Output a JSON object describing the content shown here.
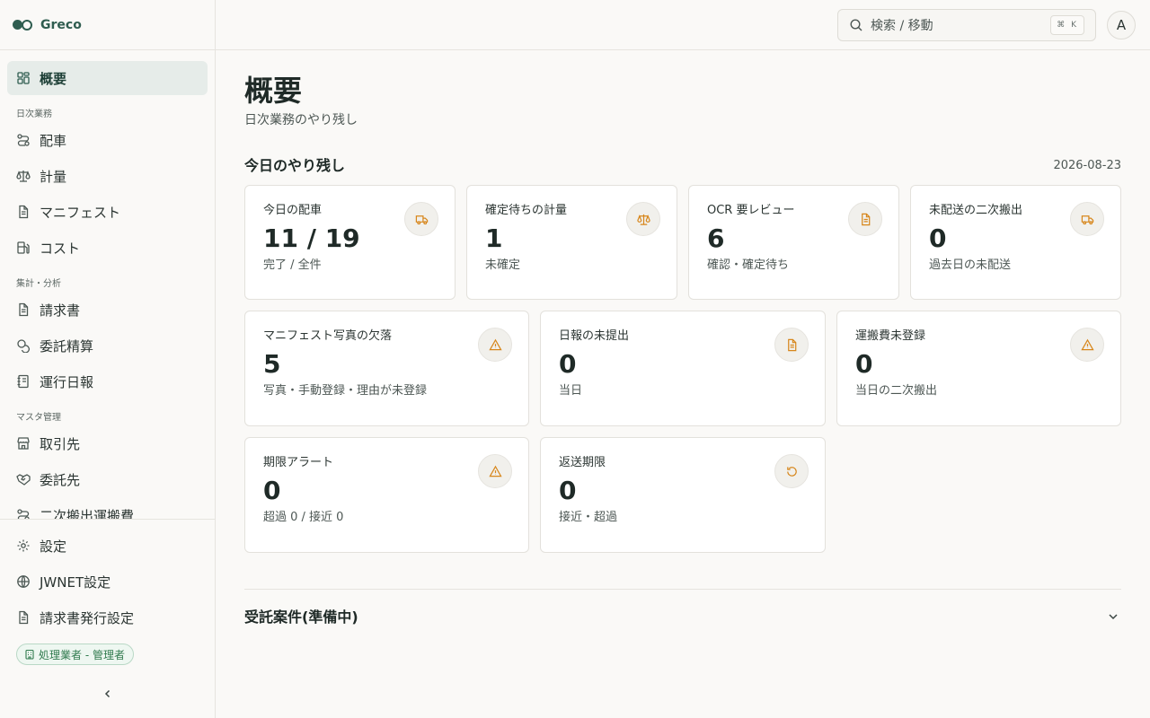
{
  "app": {
    "name": "Greco"
  },
  "sidebar": {
    "items": [
      {
        "label": "概要",
        "icon": "dashboard-icon",
        "active": true
      },
      {
        "section": "日次業務"
      },
      {
        "label": "配車",
        "icon": "route-icon"
      },
      {
        "label": "計量",
        "icon": "scale-icon"
      },
      {
        "label": "マニフェスト",
        "icon": "document-icon"
      },
      {
        "label": "コスト",
        "icon": "fuel-icon"
      },
      {
        "section": "集計・分析"
      },
      {
        "label": "請求書",
        "icon": "document-icon"
      },
      {
        "label": "委託精算",
        "icon": "coins-icon"
      },
      {
        "label": "運行日報",
        "icon": "notebook-icon"
      },
      {
        "section": "マスタ管理"
      },
      {
        "label": "取引先",
        "icon": "store-icon"
      },
      {
        "label": "委託先",
        "icon": "handshake-icon"
      },
      {
        "label": "二次搬出運搬費",
        "icon": "route-icon"
      }
    ],
    "bottom": [
      {
        "label": "設定",
        "icon": "gear-icon"
      },
      {
        "label": "JWNET設定",
        "icon": "globe-icon"
      },
      {
        "label": "請求書発行設定",
        "icon": "document-icon"
      }
    ],
    "role_badge": "処理業者 - 管理者"
  },
  "topbar": {
    "search_placeholder": "検索 / 移動",
    "shortcut": "⌘ K",
    "avatar_initial": "A"
  },
  "page": {
    "title": "概要",
    "subtitle": "日次業務のやり残し",
    "section_title": "今日のやり残し",
    "date": "2026-08-23"
  },
  "cards": [
    {
      "label": "今日の配車",
      "value": "11 / 19",
      "note": "完了 / 全件",
      "icon": "truck-icon"
    },
    {
      "label": "確定待ちの計量",
      "value": "1",
      "note": "未確定",
      "icon": "scale-icon"
    },
    {
      "label": "OCR 要レビュー",
      "value": "6",
      "note": "確認・確定待ち",
      "icon": "document-icon"
    },
    {
      "label": "未配送の二次搬出",
      "value": "0",
      "note": "過去日の未配送",
      "icon": "truck-icon"
    },
    {
      "label": "マニフェスト写真の欠落",
      "value": "5",
      "note": "写真・手動登録・理由が未登録",
      "icon": "warning-icon"
    },
    {
      "label": "日報の未提出",
      "value": "0",
      "note": "当日",
      "icon": "document-icon"
    },
    {
      "label": "運搬費未登録",
      "value": "0",
      "note": "当日の二次搬出",
      "icon": "warning-icon"
    },
    {
      "label": "期限アラート",
      "value": "0",
      "note": "超過 0 / 接近 0",
      "icon": "warning-icon"
    },
    {
      "label": "返送期限",
      "value": "0",
      "note": "接近・超過",
      "icon": "refresh-icon"
    }
  ],
  "accordion": {
    "title": "受託案件(準備中)"
  },
  "colors": {
    "accent": "#2f5d50",
    "warning": "#d7861b",
    "badge": "#2f7a4d"
  }
}
